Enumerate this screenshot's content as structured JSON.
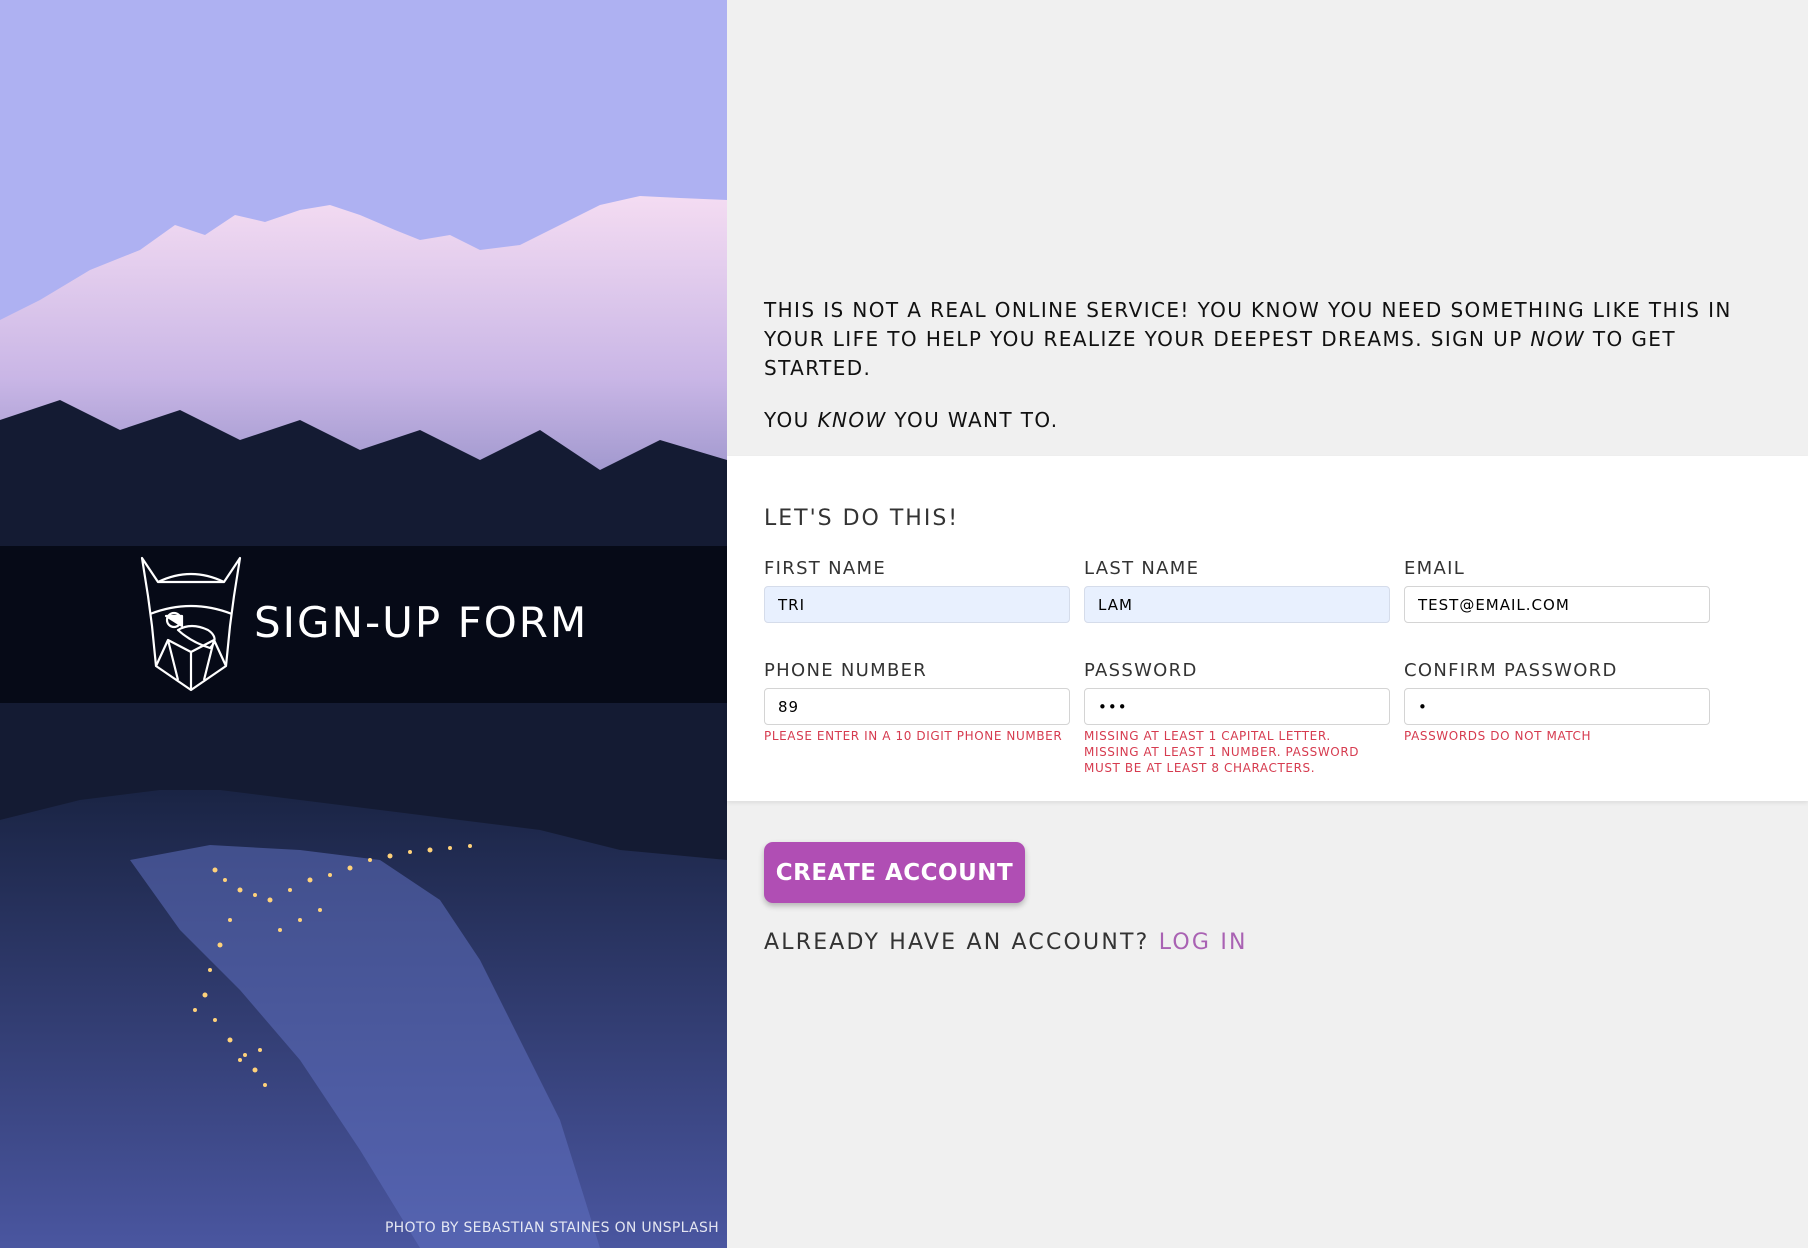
{
  "hero": {
    "brand_title": "SIGN-UP FORM",
    "logo_icon": "odin-helmet-logo-icon",
    "photo_credit": "PHOTO BY SEBASTIAN STAINES ON UNSPLASH"
  },
  "intro": {
    "p1_before": "THIS IS NOT A REAL ONLINE SERVICE! YOU KNOW YOU NEED SOMETHING LIKE THIS IN YOUR LIFE TO HELP YOU REALIZE YOUR DEEPEST DREAMS. SIGN UP ",
    "p1_em": "NOW",
    "p1_after": " TO GET STARTED.",
    "p2_before": "YOU ",
    "p2_em": "KNOW",
    "p2_after": " YOU WANT TO."
  },
  "form": {
    "heading": "LET'S DO THIS!",
    "first_name": {
      "label": "FIRST NAME",
      "value": "TRI"
    },
    "last_name": {
      "label": "LAST NAME",
      "value": "LAM"
    },
    "email": {
      "label": "EMAIL",
      "value": "TEST@EMAIL.COM"
    },
    "phone": {
      "label": "PHONE NUMBER",
      "value": "89",
      "error": "PLEASE ENTER IN A 10 DIGIT PHONE NUMBER"
    },
    "password": {
      "label": "PASSWORD",
      "value": "abc",
      "error": "MISSING AT LEAST 1 CAPITAL LETTER. MISSING AT LEAST 1 NUMBER. PASSWORD MUST BE AT LEAST 8 CHARACTERS."
    },
    "confirm_password": {
      "label": "CONFIRM PASSWORD",
      "value": "a",
      "error": "PASSWORDS DO NOT MATCH"
    }
  },
  "actions": {
    "create_label": "CREATE ACCOUNT",
    "login_prompt": "ALREADY HAVE AN ACCOUNT?",
    "login_link": "LOG IN"
  },
  "colors": {
    "accent": "#b04eb4",
    "link": "#a962b3",
    "error": "#d63b4f",
    "page_bg": "#f0f0f0",
    "autofill_bg": "#e8f0fe"
  }
}
